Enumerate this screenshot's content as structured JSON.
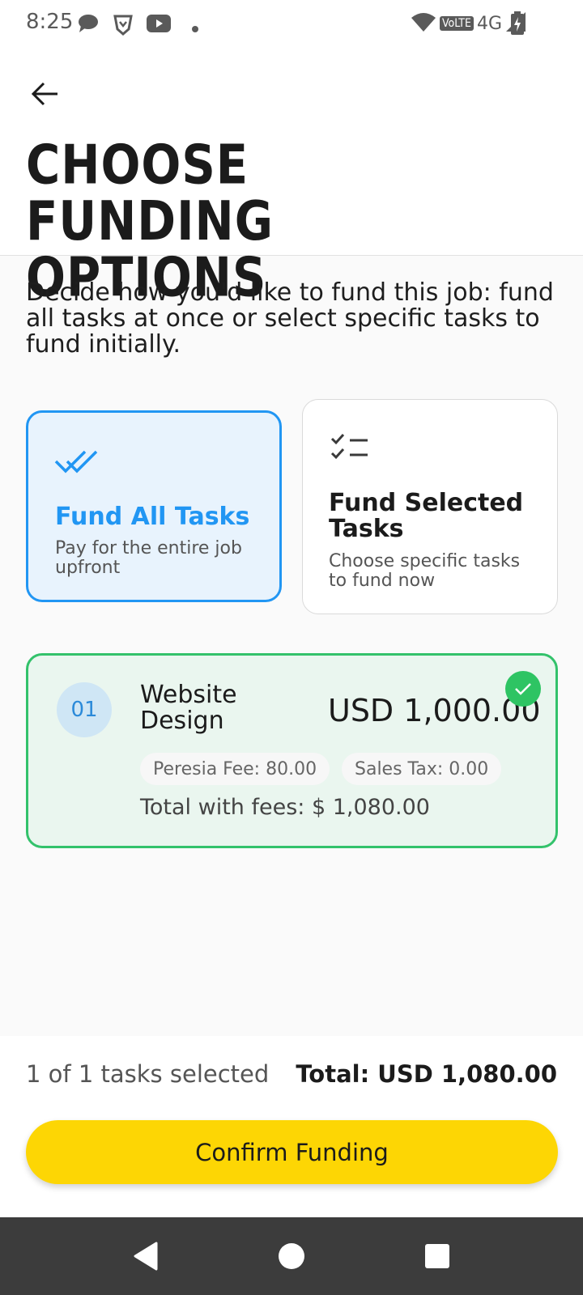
{
  "status_bar": {
    "time": "8:25",
    "network_badge": "VoLTE",
    "network_type": "4G",
    "icons": [
      "chat-icon",
      "brave-icon",
      "youtube-icon",
      "dot-icon",
      "wifi-icon",
      "signal-icon",
      "battery-charging-icon"
    ]
  },
  "header": {
    "back_icon": "arrow-back-icon",
    "title": "CHOOSE FUNDING OPTIONS"
  },
  "description": "Decide how you'd like to fund this job: fund all tasks at once or select specific tasks to fund initially.",
  "options": [
    {
      "icon": "double-check-icon",
      "title": "Fund All Tasks",
      "description": "Pay for the entire job upfront",
      "selected": true
    },
    {
      "icon": "checklist-icon",
      "title": "Fund Selected Tasks",
      "description": "Choose specific tasks to fund now",
      "selected": false
    }
  ],
  "task": {
    "number": "01",
    "name": "Website Design",
    "amount": "USD 1,000.00",
    "fee": "Peresia Fee: 80.00",
    "tax": "Sales Tax: 0.00",
    "total": "Total with fees: $ 1,080.00",
    "checked": true
  },
  "footer": {
    "selected_count": "1 of 1 tasks selected",
    "total": "Total: USD 1,080.00",
    "confirm_label": "Confirm Funding"
  },
  "colors": {
    "accent_blue": "#2196f3",
    "selected_bg": "#e8f3fd",
    "success_green": "#33c26b",
    "task_bg": "#eaf6ef",
    "button_yellow": "#fdd604",
    "nav_bar": "#3c3c3c"
  }
}
